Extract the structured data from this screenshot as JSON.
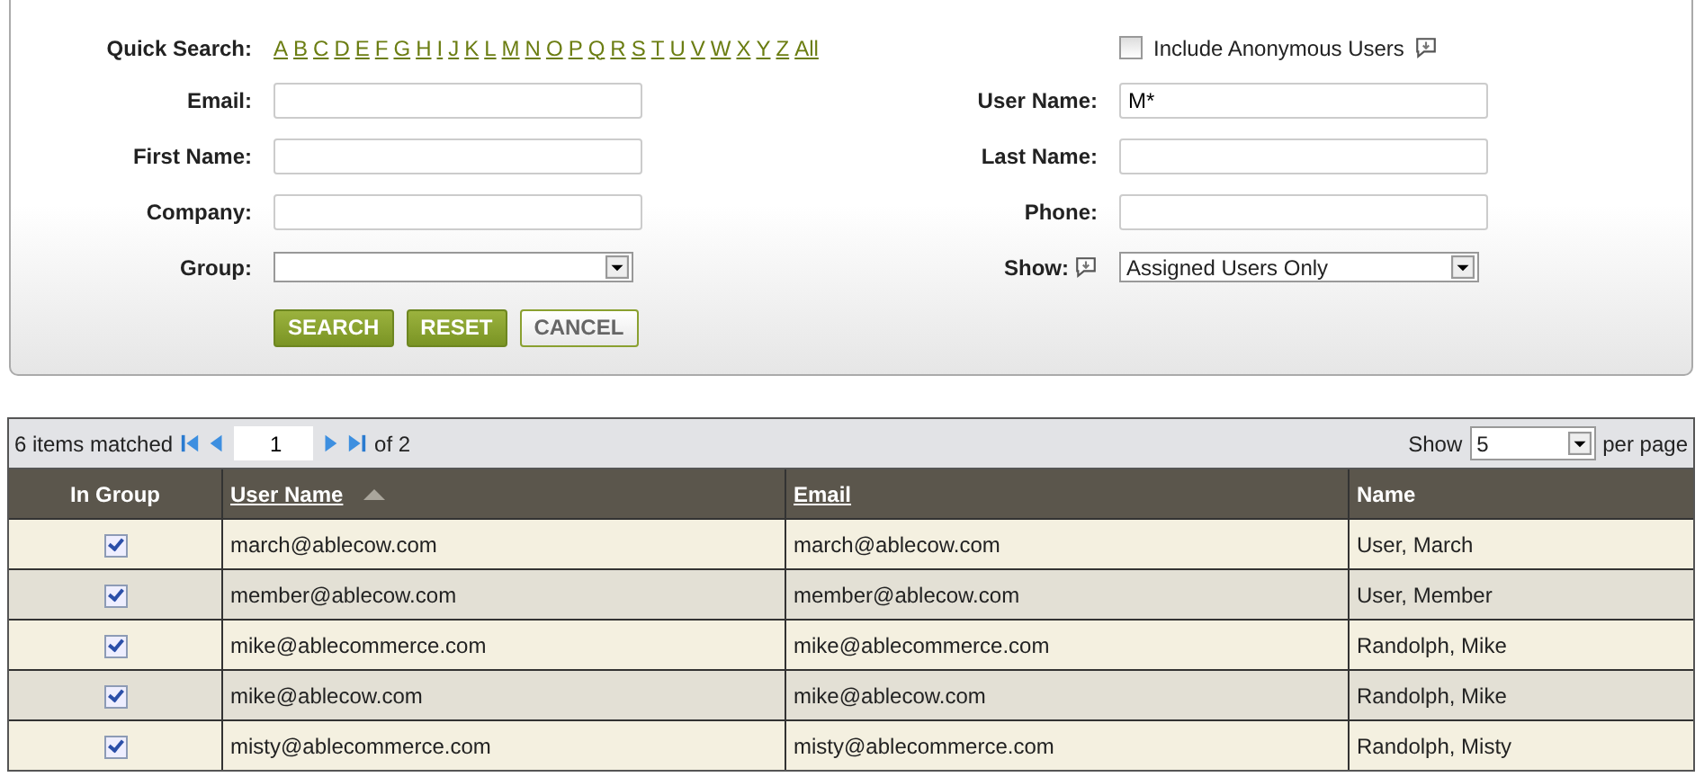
{
  "search": {
    "quick_search": {
      "label": "Quick Search:",
      "letters": [
        "A",
        "B",
        "C",
        "D",
        "E",
        "F",
        "G",
        "H",
        "I",
        "J",
        "K",
        "L",
        "M",
        "N",
        "O",
        "P",
        "Q",
        "R",
        "S",
        "T",
        "U",
        "V",
        "W",
        "X",
        "Y",
        "Z",
        "All"
      ]
    },
    "anonymous": {
      "label": "Include Anonymous Users",
      "checked": false
    },
    "left_fields": [
      {
        "label": "Email:",
        "kind": "text"
      },
      {
        "label": "First Name:",
        "kind": "text"
      },
      {
        "label": "Company:",
        "kind": "text"
      },
      {
        "label": "Group:",
        "kind": "select"
      }
    ],
    "right_fields": [
      {
        "label": "User Name:",
        "kind": "text",
        "value": "M*"
      },
      {
        "label": "Last Name:",
        "kind": "text"
      },
      {
        "label": "Phone:",
        "kind": "text"
      },
      {
        "label": "Show:",
        "kind": "select",
        "value": "Assigned Users Only",
        "help": true
      }
    ],
    "buttons": [
      {
        "label": "SEARCH",
        "kind": "primary"
      },
      {
        "label": "RESET",
        "kind": "primary"
      },
      {
        "label": "CANCEL",
        "kind": "secondary"
      }
    ]
  },
  "pager": {
    "matched": "6 items matched",
    "page": "1",
    "of": "of 2",
    "show_label": "Show",
    "per_page": "5",
    "per_page_suffix": "per page"
  },
  "table": {
    "columns": [
      {
        "label": "In Group",
        "link": false,
        "sorted_ascending": false
      },
      {
        "label": "User Name",
        "link": true,
        "sorted_ascending": true
      },
      {
        "label": "Email",
        "link": true,
        "sorted_ascending": false
      },
      {
        "label": "Name",
        "link": false,
        "sorted_ascending": false
      }
    ],
    "rows": [
      {
        "in_group": true,
        "user_name": "march@ablecow.com",
        "email": "march@ablecow.com",
        "name": "User, March"
      },
      {
        "in_group": true,
        "user_name": "member@ablecow.com",
        "email": "member@ablecow.com",
        "name": "User, Member"
      },
      {
        "in_group": true,
        "user_name": "mike@ablecommerce.com",
        "email": "mike@ablecommerce.com",
        "name": "Randolph, Mike"
      },
      {
        "in_group": true,
        "user_name": "mike@ablecow.com",
        "email": "mike@ablecow.com",
        "name": "Randolph, Mike"
      },
      {
        "in_group": true,
        "user_name": "misty@ablecommerce.com",
        "email": "misty@ablecommerce.com",
        "name": "Randolph, Misty"
      }
    ]
  }
}
